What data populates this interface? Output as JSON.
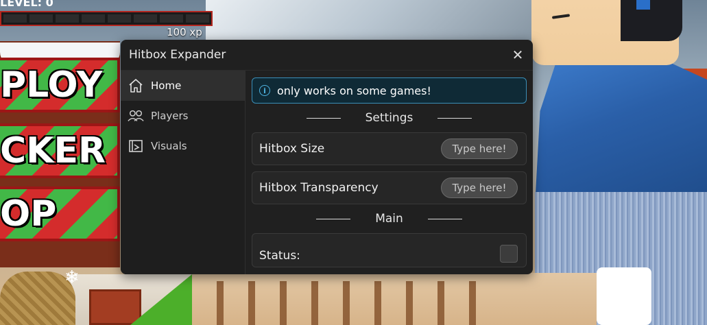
{
  "game": {
    "xp_label": "100 xp",
    "hud_top_text": "LEVEL: 0",
    "buttons": [
      {
        "label": "PLOY"
      },
      {
        "label": "CKER"
      },
      {
        "label": "OP"
      }
    ]
  },
  "window": {
    "title": "Hitbox Expander",
    "close_icon": "close-icon",
    "sidebar": {
      "items": [
        {
          "label": "Home",
          "icon": "home-icon",
          "active": true
        },
        {
          "label": "Players",
          "icon": "players-icon",
          "active": false
        },
        {
          "label": "Visuals",
          "icon": "visuals-icon",
          "active": false
        }
      ]
    },
    "notice": {
      "icon": "info-icon",
      "text": "only works on some games!"
    },
    "sections": {
      "settings": "Settings",
      "main": "Main"
    },
    "settings_rows": [
      {
        "label": "Hitbox Size",
        "placeholder": "Type here!"
      },
      {
        "label": "Hitbox Transparency",
        "placeholder": "Type here!"
      }
    ],
    "main_rows": [
      {
        "label": "Status:"
      }
    ]
  },
  "colors": {
    "accent": "#3b8fb8",
    "window_bg": "#202020",
    "active_item": "#2f2f2f"
  }
}
